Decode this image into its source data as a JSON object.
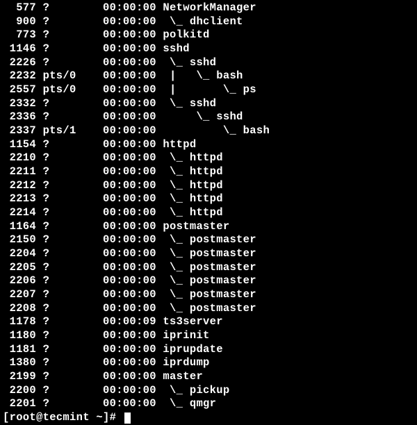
{
  "processes": [
    {
      "pid": "577",
      "tty": "?",
      "time": "00:00:00",
      "tree": "",
      "cmd": "NetworkManager"
    },
    {
      "pid": "900",
      "tty": "?",
      "time": "00:00:00",
      "tree": " \\_ ",
      "cmd": "dhclient"
    },
    {
      "pid": "773",
      "tty": "?",
      "time": "00:00:00",
      "tree": "",
      "cmd": "polkitd"
    },
    {
      "pid": "1146",
      "tty": "?",
      "time": "00:00:00",
      "tree": "",
      "cmd": "sshd"
    },
    {
      "pid": "2226",
      "tty": "?",
      "time": "00:00:00",
      "tree": " \\_ ",
      "cmd": "sshd"
    },
    {
      "pid": "2232",
      "tty": "pts/0",
      "time": "00:00:00",
      "tree": " |   \\_ ",
      "cmd": "bash"
    },
    {
      "pid": "2557",
      "tty": "pts/0",
      "time": "00:00:00",
      "tree": " |       \\_ ",
      "cmd": "ps"
    },
    {
      "pid": "2332",
      "tty": "?",
      "time": "00:00:00",
      "tree": " \\_ ",
      "cmd": "sshd"
    },
    {
      "pid": "2336",
      "tty": "?",
      "time": "00:00:00",
      "tree": "     \\_ ",
      "cmd": "sshd"
    },
    {
      "pid": "2337",
      "tty": "pts/1",
      "time": "00:00:00",
      "tree": "         \\_ ",
      "cmd": "bash"
    },
    {
      "pid": "1154",
      "tty": "?",
      "time": "00:00:00",
      "tree": "",
      "cmd": "httpd"
    },
    {
      "pid": "2210",
      "tty": "?",
      "time": "00:00:00",
      "tree": " \\_ ",
      "cmd": "httpd"
    },
    {
      "pid": "2211",
      "tty": "?",
      "time": "00:00:00",
      "tree": " \\_ ",
      "cmd": "httpd"
    },
    {
      "pid": "2212",
      "tty": "?",
      "time": "00:00:00",
      "tree": " \\_ ",
      "cmd": "httpd"
    },
    {
      "pid": "2213",
      "tty": "?",
      "time": "00:00:00",
      "tree": " \\_ ",
      "cmd": "httpd"
    },
    {
      "pid": "2214",
      "tty": "?",
      "time": "00:00:00",
      "tree": " \\_ ",
      "cmd": "httpd"
    },
    {
      "pid": "1164",
      "tty": "?",
      "time": "00:00:00",
      "tree": "",
      "cmd": "postmaster"
    },
    {
      "pid": "2150",
      "tty": "?",
      "time": "00:00:00",
      "tree": " \\_ ",
      "cmd": "postmaster"
    },
    {
      "pid": "2204",
      "tty": "?",
      "time": "00:00:00",
      "tree": " \\_ ",
      "cmd": "postmaster"
    },
    {
      "pid": "2205",
      "tty": "?",
      "time": "00:00:00",
      "tree": " \\_ ",
      "cmd": "postmaster"
    },
    {
      "pid": "2206",
      "tty": "?",
      "time": "00:00:00",
      "tree": " \\_ ",
      "cmd": "postmaster"
    },
    {
      "pid": "2207",
      "tty": "?",
      "time": "00:00:00",
      "tree": " \\_ ",
      "cmd": "postmaster"
    },
    {
      "pid": "2208",
      "tty": "?",
      "time": "00:00:00",
      "tree": " \\_ ",
      "cmd": "postmaster"
    },
    {
      "pid": "1178",
      "tty": "?",
      "time": "00:00:09",
      "tree": "",
      "cmd": "ts3server"
    },
    {
      "pid": "1180",
      "tty": "?",
      "time": "00:00:00",
      "tree": "",
      "cmd": "iprinit"
    },
    {
      "pid": "1181",
      "tty": "?",
      "time": "00:00:00",
      "tree": "",
      "cmd": "iprupdate"
    },
    {
      "pid": "1380",
      "tty": "?",
      "time": "00:00:00",
      "tree": "",
      "cmd": "iprdump"
    },
    {
      "pid": "2199",
      "tty": "?",
      "time": "00:00:00",
      "tree": "",
      "cmd": "master"
    },
    {
      "pid": "2200",
      "tty": "?",
      "time": "00:00:00",
      "tree": " \\_ ",
      "cmd": "pickup"
    },
    {
      "pid": "2201",
      "tty": "?",
      "time": "00:00:00",
      "tree": " \\_ ",
      "cmd": "qmgr"
    }
  ],
  "prompt": "[root@tecmint ~]# "
}
